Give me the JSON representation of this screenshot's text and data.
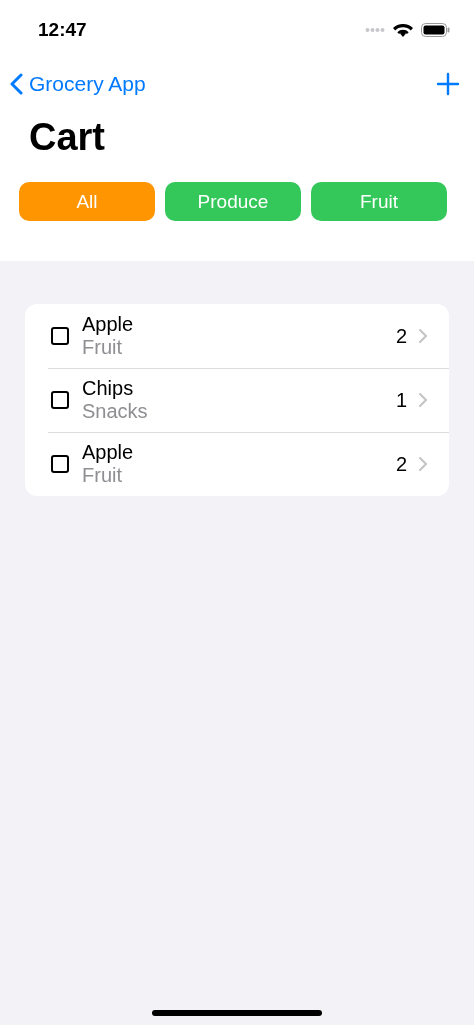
{
  "status_bar": {
    "time": "12:47"
  },
  "nav": {
    "back_label": "Grocery App"
  },
  "title": "Cart",
  "filters": [
    {
      "label": "All",
      "selected": true
    },
    {
      "label": "Produce",
      "selected": false
    },
    {
      "label": "Fruit",
      "selected": false
    }
  ],
  "items": [
    {
      "name": "Apple",
      "category": "Fruit",
      "quantity": "2",
      "checked": false
    },
    {
      "name": "Chips",
      "category": "Snacks",
      "quantity": "1",
      "checked": false
    },
    {
      "name": "Apple",
      "category": "Fruit",
      "quantity": "2",
      "checked": false
    }
  ]
}
